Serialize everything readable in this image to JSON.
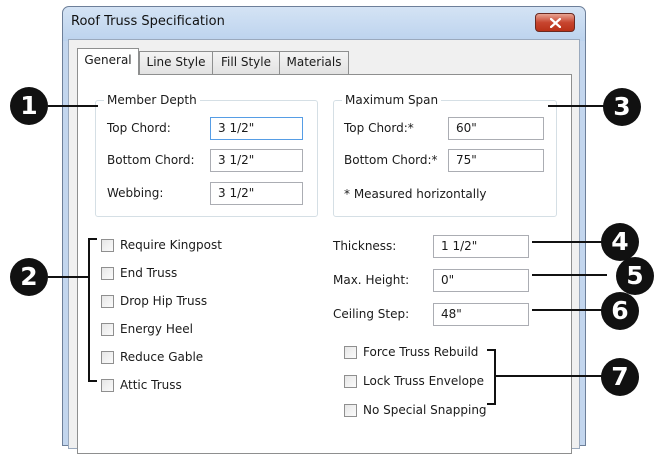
{
  "dialog": {
    "title": "Roof Truss Specification",
    "close_icon": "close-x-icon",
    "close_color": "#c7452f"
  },
  "tabs": [
    {
      "label": "General",
      "active": true
    },
    {
      "label": "Line Style",
      "active": false
    },
    {
      "label": "Fill Style",
      "active": false
    },
    {
      "label": "Materials",
      "active": false
    }
  ],
  "member_depth": {
    "title": "Member Depth",
    "top_chord": {
      "label": "Top Chord:",
      "value": "3 1/2\""
    },
    "bottom_chord": {
      "label": "Bottom Chord:",
      "value": "3 1/2\""
    },
    "webbing": {
      "label": "Webbing:",
      "value": "3 1/2\""
    }
  },
  "maximum_span": {
    "title": "Maximum Span",
    "top_chord": {
      "label": "Top Chord:*",
      "value": "60\""
    },
    "bottom_chord": {
      "label": "Bottom Chord:*",
      "value": "75\""
    },
    "note": "* Measured horizontally"
  },
  "options": [
    {
      "label": "Require Kingpost",
      "checked": false
    },
    {
      "label": "End Truss",
      "checked": false
    },
    {
      "label": "Drop Hip Truss",
      "checked": false
    },
    {
      "label": "Energy Heel",
      "checked": false
    },
    {
      "label": "Reduce Gable",
      "checked": false
    },
    {
      "label": "Attic Truss",
      "checked": false
    }
  ],
  "dimensions": {
    "thickness": {
      "label": "Thickness:",
      "value": "1 1/2\""
    },
    "max_height": {
      "label": "Max. Height:",
      "value": "0\""
    },
    "ceiling_step": {
      "label": "Ceiling Step:",
      "value": "48\""
    }
  },
  "rebuild_options": [
    {
      "label": "Force Truss Rebuild",
      "checked": false
    },
    {
      "label": "Lock Truss Envelope",
      "checked": false
    },
    {
      "label": "No Special Snapping",
      "checked": false
    }
  ],
  "callouts": [
    "1",
    "2",
    "3",
    "4",
    "5",
    "6",
    "7"
  ]
}
